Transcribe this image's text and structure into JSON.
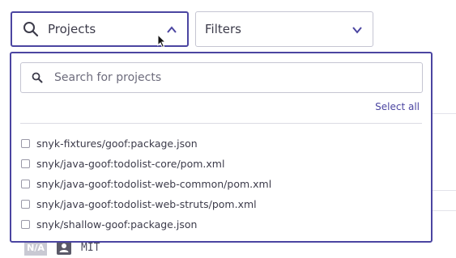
{
  "toolbar": {
    "projects_label": "Projects",
    "filters_label": "Filters"
  },
  "panel": {
    "search": {
      "placeholder": "Search for projects",
      "value": ""
    },
    "select_all_label": "Select all",
    "projects": [
      {
        "name": "snyk-fixtures/goof:package.json",
        "checked": false
      },
      {
        "name": "snyk/java-goof:todolist-core/pom.xml",
        "checked": false
      },
      {
        "name": "snyk/java-goof:todolist-web-common/pom.xml",
        "checked": false
      },
      {
        "name": "snyk/java-goof:todolist-web-struts/pom.xml",
        "checked": false
      },
      {
        "name": "snyk/shallow-goof:package.json",
        "checked": false
      }
    ]
  },
  "background_row": {
    "badge": "N/A",
    "license": "MIT"
  },
  "colors": {
    "accent": "#4b45a1",
    "border": "#c5c5d2",
    "text": "#3c3b4a"
  }
}
